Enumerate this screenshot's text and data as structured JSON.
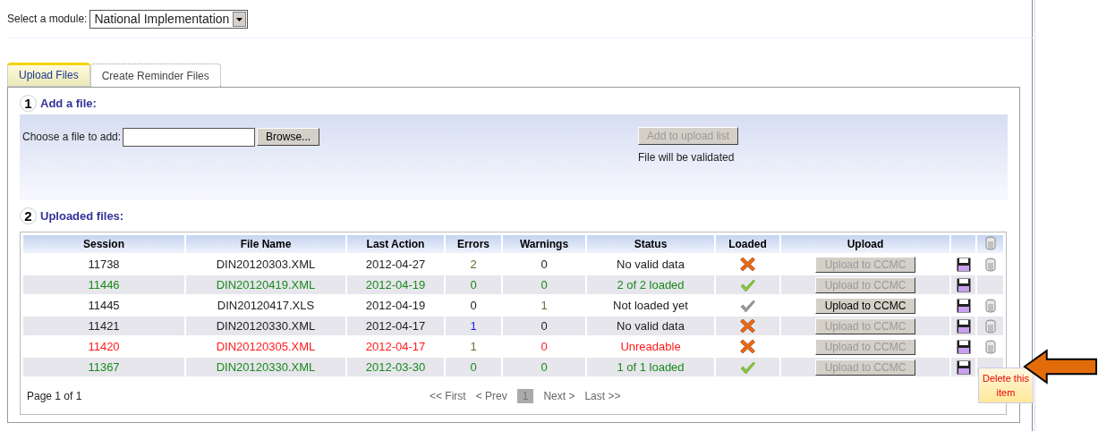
{
  "module_select": {
    "label": "Select a module:",
    "value": "National Implementation"
  },
  "tabs": [
    {
      "label": "Upload Files",
      "selected": true
    },
    {
      "label": "Create Reminder Files",
      "selected": false
    }
  ],
  "add_section": {
    "number": "1",
    "title": "Add a file:",
    "file_label": "Choose a file to add:",
    "browse_button": "Browse...",
    "add_button": {
      "label": "Add to upload list",
      "disabled": true
    },
    "note": "File will be validated"
  },
  "files_section": {
    "number": "2",
    "title": "Uploaded files:"
  },
  "table": {
    "columns": [
      "Session",
      "File Name",
      "Last Action",
      "Errors",
      "Warnings",
      "Status",
      "Loaded",
      "Upload"
    ],
    "rows": [
      {
        "color": "#222222",
        "session": "11738",
        "file": "DIN20120303.XML",
        "last_action": "2012-04-27",
        "errors": {
          "value": "2",
          "color": "#6b6b2a"
        },
        "warnings": {
          "value": "0",
          "color": "#222222"
        },
        "status": "No valid data",
        "loaded": {
          "kind": "cross"
        },
        "upload": {
          "label": "Upload to CCMC",
          "disabled": true
        },
        "deletable": true
      },
      {
        "color": "#1a8a1a",
        "session": "11446",
        "file": "DIN20120419.XML",
        "last_action": "2012-04-19",
        "errors": {
          "value": "0",
          "color": "#1a8a1a"
        },
        "warnings": {
          "value": "0",
          "color": "#1a8a1a"
        },
        "status": "2 of 2 loaded",
        "loaded": {
          "kind": "check"
        },
        "upload": {
          "label": "Upload to CCMC",
          "disabled": true
        },
        "deletable": false
      },
      {
        "color": "#222222",
        "session": "11445",
        "file": "DIN20120417.XLS",
        "last_action": "2012-04-19",
        "errors": {
          "value": "0",
          "color": "#222222"
        },
        "warnings": {
          "value": "1",
          "color": "#6b6b2a"
        },
        "status": "Not loaded yet",
        "loaded": {
          "kind": "check_grey"
        },
        "upload": {
          "label": "Upload to CCMC",
          "disabled": false
        },
        "deletable": true
      },
      {
        "color": "#222222",
        "session": "11421",
        "file": "DIN20120330.XML",
        "last_action": "2012-04-17",
        "errors": {
          "value": "1",
          "color": "#1a1aff"
        },
        "warnings": {
          "value": "0",
          "color": "#222222"
        },
        "status": "No valid data",
        "loaded": {
          "kind": "cross"
        },
        "upload": {
          "label": "Upload to CCMC",
          "disabled": true
        },
        "deletable": true
      },
      {
        "color": "#ff1a1a",
        "session": "11420",
        "file": "DIN20120305.XML",
        "last_action": "2012-04-17",
        "errors": {
          "value": "1",
          "color": "#6b6b2a"
        },
        "warnings": {
          "value": "0",
          "color": "#ff1a1a"
        },
        "status": "Unreadable",
        "loaded": {
          "kind": "cross"
        },
        "upload": {
          "label": "Upload to CCMC",
          "disabled": true
        },
        "deletable": true
      },
      {
        "color": "#1a8a1a",
        "session": "11367",
        "file": "DIN20120330.XML",
        "last_action": "2012-03-30",
        "errors": {
          "value": "0",
          "color": "#1a8a1a"
        },
        "warnings": {
          "value": "0",
          "color": "#1a8a1a"
        },
        "status": "1 of 1 loaded",
        "loaded": {
          "kind": "check"
        },
        "upload": {
          "label": "Upload to CCMC",
          "disabled": true
        },
        "deletable": false
      }
    ]
  },
  "pager": {
    "summary": "Page 1 of 1",
    "first": "<< First",
    "prev": "< Prev",
    "page": "1",
    "next": "Next >",
    "last": "Last >>"
  },
  "tooltip": "Delete this item"
}
